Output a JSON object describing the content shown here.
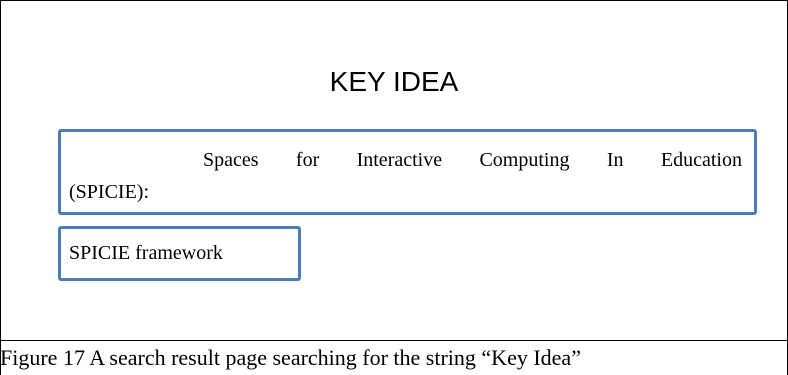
{
  "slide": {
    "title": "KEY IDEA",
    "boxes": [
      {
        "line1_words": [
          "Spaces",
          "for",
          "Interactive",
          "Computing",
          "In",
          "Education"
        ],
        "line2": "(SPICIE):"
      },
      {
        "text": "SPICIE framework"
      }
    ]
  },
  "caption": "Figure 17 A search result page searching for the string “Key Idea”"
}
